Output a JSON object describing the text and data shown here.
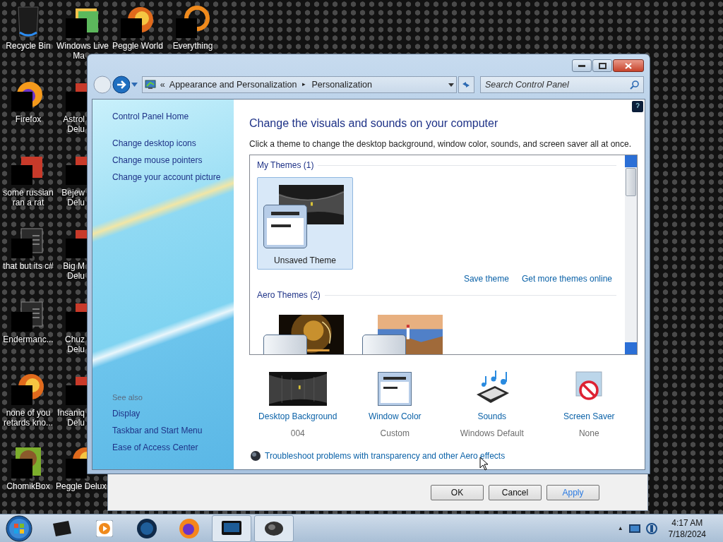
{
  "desktop_icons": [
    {
      "label_lines": [
        "Recycle Bin"
      ],
      "kind": "bin",
      "redacted": false
    },
    {
      "label_lines": [
        "Windows Live",
        "Ma"
      ],
      "kind": "photos",
      "redacted": true
    },
    {
      "label_lines": [
        "Peggle World"
      ],
      "kind": "orb",
      "redacted": true
    },
    {
      "label_lines": [
        "Everything"
      ],
      "kind": "ring",
      "redacted": true
    },
    {
      "label_lines": [
        "Firefox"
      ],
      "kind": "firefox",
      "redacted": true
    },
    {
      "label_lines": [
        "Astrol",
        "Delu"
      ],
      "kind": "app",
      "redacted": true
    },
    {
      "label_lines": [
        "some russian",
        "ran a rat"
      ],
      "kind": "app",
      "redacted": true
    },
    {
      "label_lines": [
        "Bejew",
        "Delu"
      ],
      "kind": "app",
      "redacted": true
    },
    {
      "label_lines": [
        "that but its c#"
      ],
      "kind": "window",
      "redacted": true
    },
    {
      "label_lines": [
        "Big M",
        "Delu"
      ],
      "kind": "app",
      "redacted": true
    },
    {
      "label_lines": [
        "Endermanc..."
      ],
      "kind": "window",
      "redacted": true
    },
    {
      "label_lines": [
        "Chuz",
        "Delu"
      ],
      "kind": "app",
      "redacted": true
    },
    {
      "label_lines": [
        "none of you",
        "retards kno..."
      ],
      "kind": "orb",
      "redacted": true
    },
    {
      "label_lines": [
        "Insaniq",
        "Delu"
      ],
      "kind": "app",
      "redacted": true
    },
    {
      "label_lines": [
        "ChomikBox"
      ],
      "kind": "bear",
      "redacted": true
    },
    {
      "label_lines": [
        "Peggle Delux"
      ],
      "kind": "orb",
      "redacted": true
    }
  ],
  "window": {
    "address": {
      "overflow": "«",
      "crumbs": [
        "Appearance and Personalization",
        "Personalization"
      ],
      "separator": "▸"
    },
    "search": {
      "placeholder": "Search Control Panel"
    },
    "sidebar": {
      "home": "Control Panel Home",
      "links": [
        "Change desktop icons",
        "Change mouse pointers",
        "Change your account picture"
      ],
      "see_also": {
        "heading": "See also",
        "links": [
          "Display",
          "Taskbar and Start Menu",
          "Ease of Access Center"
        ]
      }
    },
    "heading": "Change the visuals and sounds on your computer",
    "description": "Click a theme to change the desktop background, window color, sounds, and screen saver all at once.",
    "theme_groups": [
      {
        "title": "My Themes (1)",
        "themes": [
          {
            "name": "Unsaved Theme",
            "kind": "picture",
            "selected": true
          }
        ],
        "links": [
          "Save theme",
          "Get more themes online"
        ]
      },
      {
        "title": "Aero Themes (2)"
      }
    ],
    "settings": [
      {
        "kind": "background",
        "label": "Desktop Background",
        "value": "004"
      },
      {
        "kind": "color",
        "label": "Window Color",
        "value": "Custom"
      },
      {
        "kind": "sounds",
        "label": "Sounds",
        "value": "Windows Default"
      },
      {
        "kind": "saver",
        "label": "Screen Saver",
        "value": "None"
      }
    ],
    "troubleshoot": "Troubleshoot problems with transparency and other Aero effects"
  },
  "dialog_buttons": [
    {
      "label": "OK",
      "highlighted": false
    },
    {
      "label": "Cancel",
      "highlighted": false
    },
    {
      "label": "Apply",
      "highlighted": true
    }
  ],
  "taskbar": {
    "items": [
      {
        "kind": "box",
        "open": false
      },
      {
        "kind": "player",
        "open": false
      },
      {
        "kind": "globe",
        "open": false
      },
      {
        "kind": "firefox",
        "open": false
      },
      {
        "kind": "screen",
        "open": true
      },
      {
        "kind": "mouse",
        "open": true
      }
    ],
    "tray_arrow": "▲",
    "time": "4:17 AM",
    "date": "7/18/2024"
  }
}
